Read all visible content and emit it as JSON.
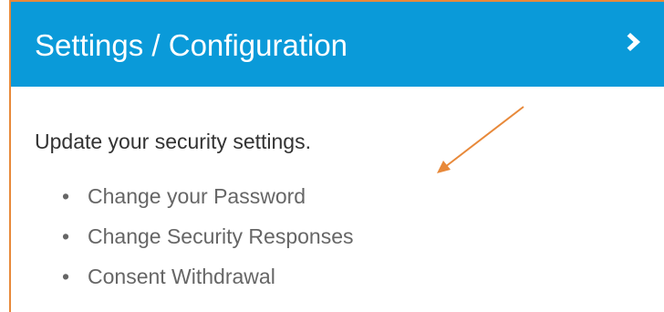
{
  "panel": {
    "title": "Settings / Configuration",
    "expand_icon": "chevron-right-icon",
    "header_color": "#0a9ad9",
    "border_color": "#e8893a"
  },
  "body": {
    "intro_text": "Update your security settings.",
    "links": [
      {
        "label": "Change your Password"
      },
      {
        "label": "Change Security Responses"
      },
      {
        "label": "Consent Withdrawal"
      }
    ]
  },
  "annotation": {
    "arrow_color": "#e8893a"
  }
}
